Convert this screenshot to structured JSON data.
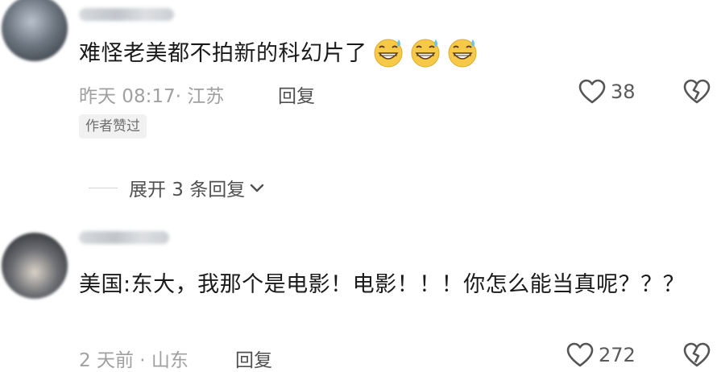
{
  "comments": [
    {
      "text": "难怪老美都不拍新的科幻片了",
      "emojis": [
        "grin-sweat-emoji",
        "grin-sweat-emoji",
        "grin-sweat-emoji"
      ],
      "time_location": "昨天 08:17· 江苏",
      "reply_label": "回复",
      "likes": "38",
      "badge": "作者赞过",
      "expand_label": "展开 3 条回复"
    },
    {
      "text": "美国:东大，我那个是电影！电影！！！你怎么能当真呢？？？",
      "time_location": "2 天前 · 山东",
      "reply_label": "回复",
      "likes": "272"
    }
  ],
  "icons": {
    "like": "heart-outline-icon",
    "dislike": "broken-heart-icon",
    "expand": "chevron-down-icon"
  },
  "colors": {
    "text": "#1a1a1a",
    "meta": "#a0a0a0",
    "badge_bg": "#f1f1f1",
    "emoji_face": "#f7c948"
  }
}
